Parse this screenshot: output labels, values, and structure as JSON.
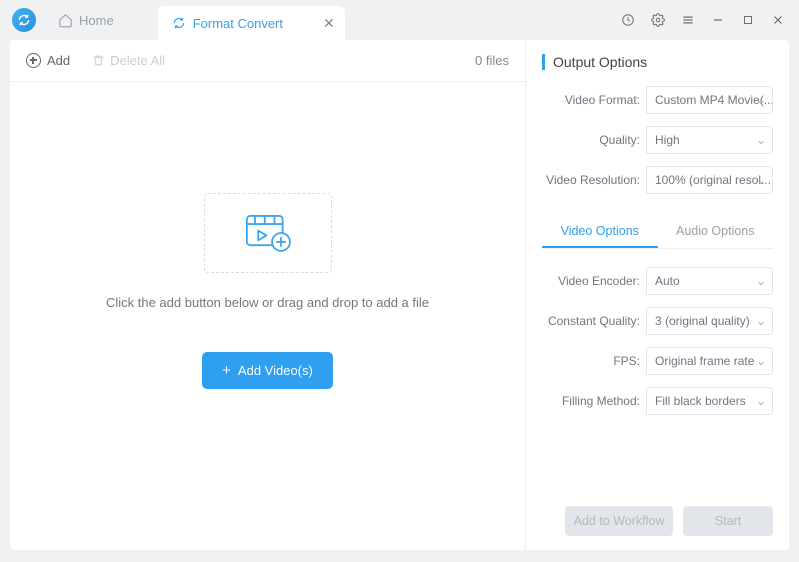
{
  "tabs": {
    "home": "Home",
    "convert": "Format Convert"
  },
  "toolbar": {
    "add": "Add",
    "delete_all": "Delete All",
    "file_count": "0 files"
  },
  "dropzone": {
    "hint": "Click the add button below or drag and drop to add a file",
    "button": "Add Video(s)"
  },
  "output": {
    "title": "Output Options",
    "video_format_label": "Video Format:",
    "video_format_value": "Custom MP4 Movie(...",
    "quality_label": "Quality:",
    "quality_value": "High",
    "resolution_label": "Video Resolution:",
    "resolution_value": "100% (original resol..."
  },
  "subtabs": {
    "video": "Video Options",
    "audio": "Audio Options"
  },
  "video_opts": {
    "encoder_label": "Video Encoder:",
    "encoder_value": "Auto",
    "cq_label": "Constant Quality:",
    "cq_value": "3 (original quality)",
    "fps_label": "FPS:",
    "fps_value": "Original frame rate",
    "fill_label": "Filling Method:",
    "fill_value": "Fill black borders"
  },
  "footer": {
    "workflow": "Add to Workflow",
    "start": "Start"
  }
}
